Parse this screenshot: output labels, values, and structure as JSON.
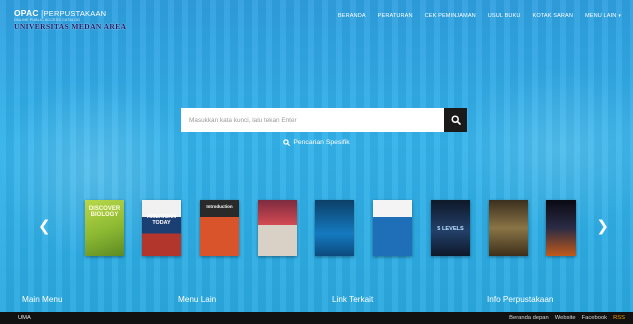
{
  "header": {
    "logo_line1": "OPAC",
    "logo_line1_suffix": "[PERPUSTAKAAN",
    "logo_line2": "ONLINE PUBLIC ACCESS CATALOG",
    "logo_line3": "UNIVERSITAS MEDAN AREA"
  },
  "nav": {
    "items": [
      "BERANDA",
      "PERATURAN",
      "CEK PEMINJAMAN",
      "USUL BUKU",
      "KOTAK SARAN",
      "MENU LAIN"
    ]
  },
  "search": {
    "placeholder": "Masukkan kata kunci, lalu tekan Enter",
    "advanced_label": "Pencarian Spesifik"
  },
  "books": [
    {
      "title": "DISCOVER BIOLOGY",
      "color": "#9bc43a"
    },
    {
      "title": "AMERICAN TODAY",
      "color": "#1c3f73"
    },
    {
      "title": "Introduction",
      "color": "#b33a1e"
    },
    {
      "title": "",
      "color": "#c0434b"
    },
    {
      "title": "",
      "color": "#0f6fa6"
    },
    {
      "title": "",
      "color": "#1e6fb8"
    },
    {
      "title": "5 LEVELS",
      "color": "#1b2a44"
    },
    {
      "title": "",
      "color": "#6b5a3c"
    },
    {
      "title": "",
      "color": "#1a1a2a"
    }
  ],
  "footer": {
    "columns": [
      "Main Menu",
      "Menu Lain",
      "Link Terkait",
      "Info Perpustakaan"
    ]
  },
  "bottom_bar": {
    "left_text": "UMA",
    "links": [
      "Beranda depan",
      "Website",
      "Facebook",
      "RSS"
    ]
  },
  "colors": {
    "accent": "#2aa6df",
    "bar": "#111111",
    "rss": "#f0a000"
  }
}
